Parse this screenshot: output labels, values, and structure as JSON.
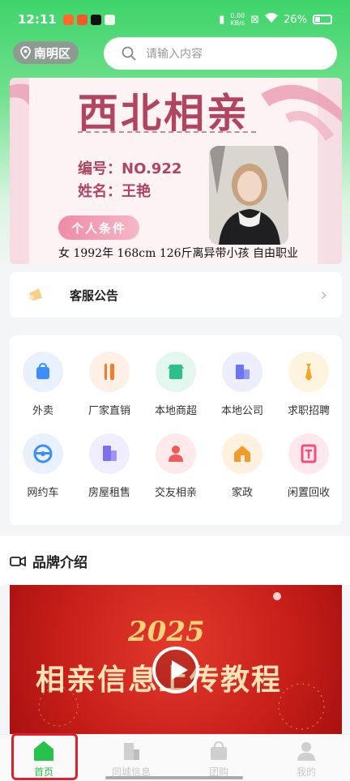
{
  "status_bar": {
    "time": "12:11",
    "speed_top": "0.00",
    "speed_bottom": "KB/s",
    "battery": "26%"
  },
  "header": {
    "location": "南明区",
    "search_placeholder": "请输入内容"
  },
  "banner": {
    "title": "西北相亲",
    "number_line": "编号：NO.922",
    "name_line": "姓名：王艳",
    "tag": "个人条件",
    "description": "女 1992年 168cm 126斤离异带小孩 自由职业"
  },
  "notice": {
    "label": "客服公告"
  },
  "categories": [
    {
      "label": "外卖",
      "icon": "shopping-bag-icon",
      "color": "#3e8ef7",
      "bg": "#e9f1ff"
    },
    {
      "label": "厂家直销",
      "icon": "fork-knife-icon",
      "color": "#f47d2c",
      "bg": "#fff0e5"
    },
    {
      "label": "本地商超",
      "icon": "store-icon",
      "color": "#2fbf8e",
      "bg": "#e3f7ef"
    },
    {
      "label": "本地公司",
      "icon": "building-icon",
      "color": "#6a76f2",
      "bg": "#eceefe"
    },
    {
      "label": "求职招聘",
      "icon": "tie-icon",
      "color": "#f5a623",
      "bg": "#fff4e0"
    },
    {
      "label": "网约车",
      "icon": "steering-wheel-icon",
      "color": "#3e8ef7",
      "bg": "#e9f1ff"
    },
    {
      "label": "房屋租售",
      "icon": "apartment-icon",
      "color": "#7c6ff0",
      "bg": "#efedfe"
    },
    {
      "label": "交友相亲",
      "icon": "people-heart-icon",
      "color": "#f05a5a",
      "bg": "#feeaea"
    },
    {
      "label": "家政",
      "icon": "house-icon",
      "color": "#f39a2c",
      "bg": "#fff1e0"
    },
    {
      "label": "闲置回收",
      "icon": "recycle-door-icon",
      "color": "#ef4f7a",
      "bg": "#fde8ee"
    }
  ],
  "brand": {
    "title": "品牌介绍",
    "video_year": "2025",
    "video_text": "相亲信息上传教程"
  },
  "tabs": [
    {
      "label": "首页",
      "icon": "home-icon"
    },
    {
      "label": "同城信息",
      "icon": "city-icon"
    },
    {
      "label": "团购",
      "icon": "bag-icon"
    },
    {
      "label": "我的",
      "icon": "user-icon"
    }
  ],
  "colors": {
    "accent": "#27c24c",
    "highlight": "#e0202c"
  }
}
